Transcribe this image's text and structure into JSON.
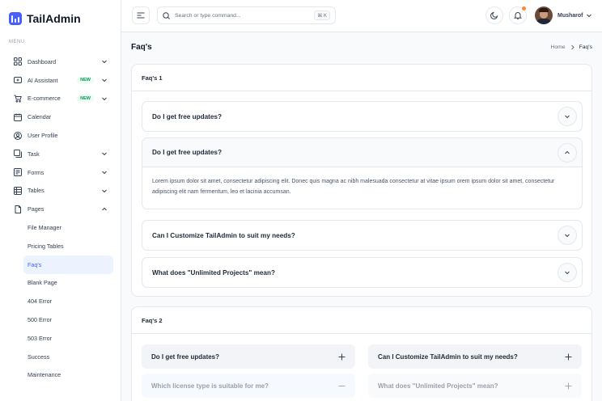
{
  "brand": {
    "name": "TailAdmin",
    "accent": "#465fff"
  },
  "sidebar": {
    "menu_label": "MENU",
    "items": [
      {
        "label": "Dashboard",
        "icon": "grid-icon",
        "chevron": "down"
      },
      {
        "label": "AI Assistant",
        "icon": "sparkle-icon",
        "badge": "NEW",
        "chevron": "down"
      },
      {
        "label": "E-commerce",
        "icon": "cart-icon",
        "badge": "NEW",
        "chevron": "down"
      },
      {
        "label": "Calendar",
        "icon": "calendar-icon"
      },
      {
        "label": "User Profile",
        "icon": "user-circle-icon"
      },
      {
        "label": "Task",
        "icon": "task-icon",
        "chevron": "down"
      },
      {
        "label": "Forms",
        "icon": "forms-icon",
        "chevron": "down"
      },
      {
        "label": "Tables",
        "icon": "table-icon",
        "chevron": "down"
      },
      {
        "label": "Pages",
        "icon": "pages-icon",
        "chevron": "up"
      }
    ],
    "sub_items": [
      {
        "label": "File Manager"
      },
      {
        "label": "Pricing Tables"
      },
      {
        "label": "Faq's",
        "active": true
      },
      {
        "label": "Blank Page"
      },
      {
        "label": "404 Error"
      },
      {
        "label": "500 Error"
      },
      {
        "label": "503 Error"
      },
      {
        "label": "Success"
      },
      {
        "label": "Maintenance"
      }
    ]
  },
  "header": {
    "search_placeholder": "Search or type command...",
    "search_shortcut": "⌘ K",
    "user_name": "Musharof"
  },
  "page": {
    "title": "Faq's",
    "breadcrumb": {
      "home": "Home",
      "current": "Faq's"
    }
  },
  "faq1": {
    "title": "Faq's 1",
    "items": [
      {
        "question": "Do I get free updates?",
        "open": false
      },
      {
        "question": "Do I get free updates?",
        "open": true,
        "answer": "Lorem ipsum dolor sit amet, consectetur adipiscing elit. Donec quis magna ac nibh malesuada consectetur at vitae ipsum orem ipsum dolor sit amet, consectetur adipiscing elit nam fermentum, leo et lacinia accumsan."
      },
      {
        "question": "Can I Customize TailAdmin to suit my needs?",
        "open": false
      },
      {
        "question": "What does \"Unlimited Projects\" mean?",
        "open": false
      }
    ]
  },
  "faq2": {
    "title": "Faq's 2",
    "items": [
      {
        "question": "Do I get free updates?"
      },
      {
        "question": "Can I Customize TailAdmin to suit my needs?"
      },
      {
        "question": "Which license type is suitable for me?"
      },
      {
        "question": "What does \"Unlimited Projects\" mean?"
      }
    ]
  }
}
